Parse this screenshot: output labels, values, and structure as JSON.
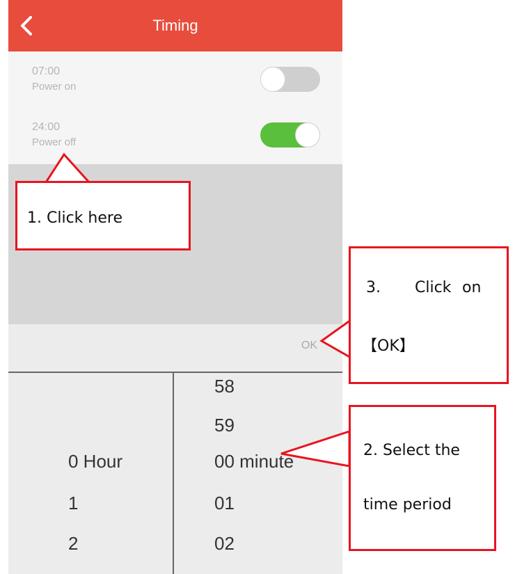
{
  "header": {
    "title": "Timing"
  },
  "schedules": [
    {
      "time": "07:00",
      "action": "Power on",
      "enabled": false
    },
    {
      "time": "24:00",
      "action": "Power off",
      "enabled": true
    }
  ],
  "ok_label": "OK",
  "picker": {
    "hours": [
      "0 Hour",
      "1",
      "2"
    ],
    "minutes": [
      "58",
      "59",
      "00 minute",
      "01",
      "02"
    ]
  },
  "annotations": {
    "step1": "1. Click here",
    "step2_line1": "2. Select the",
    "step2_line2": "time period",
    "step3_line1": "3.",
    "step3_line1b": "Click",
    "step3_line1c": "on",
    "step3_line2": "【OK】"
  },
  "colors": {
    "header": "#e84c3d",
    "toggle_on": "#5abf3c",
    "toggle_off": "#cfcfcf",
    "callout_border": "#e8141f"
  }
}
